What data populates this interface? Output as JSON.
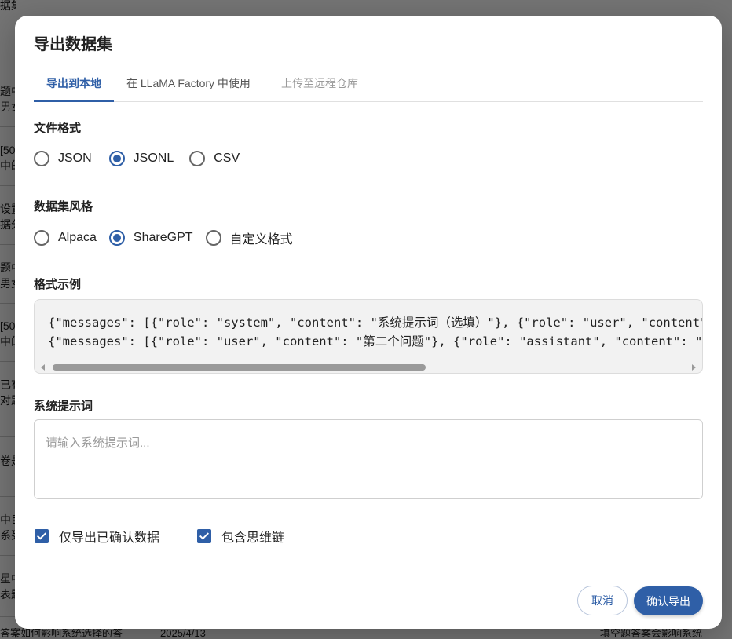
{
  "background": {
    "header_fragment": "据集",
    "row_fragments": [
      "题中",
      "男女",
      "[50",
      "中的",
      "设置",
      "据分",
      "题中",
      "男女",
      "[50",
      "中的",
      "已有",
      "对题",
      "卷是",
      "中目",
      "系列",
      "星中",
      "表题"
    ],
    "bottom_text": "答案如何影响系统选择的答",
    "bottom_date": "2025/4/13",
    "bottom_right": "填空题答案会影响系统"
  },
  "dialog": {
    "title": "导出数据集",
    "tabs": [
      {
        "label": "导出到本地",
        "state": "active"
      },
      {
        "label": "在 LLaMA Factory 中使用",
        "state": "normal"
      },
      {
        "label": "上传至远程仓库",
        "state": "disabled"
      }
    ],
    "file_format": {
      "label": "文件格式",
      "options": [
        "JSON",
        "JSONL",
        "CSV"
      ],
      "selected": "JSONL"
    },
    "dataset_style": {
      "label": "数据集风格",
      "options": [
        "Alpaca",
        "ShareGPT",
        "自定义格式"
      ],
      "selected": "ShareGPT"
    },
    "format_example": {
      "label": "格式示例",
      "lines": [
        "{\"messages\": [{\"role\": \"system\", \"content\": \"系统提示词（选填）\"}, {\"role\": \"user\", \"content\": \"问题\"}, {\"role\": \"assistant\", \"content\": \"答案\"}]}",
        "{\"messages\": [{\"role\": \"user\", \"content\": \"第二个问题\"}, {\"role\": \"assistant\", \"content\": \"第二个答案\"}]}"
      ]
    },
    "system_prompt": {
      "label": "系统提示词",
      "placeholder": "请输入系统提示词...",
      "value": ""
    },
    "checkboxes": [
      {
        "label": "仅导出已确认数据",
        "checked": true
      },
      {
        "label": "包含思维链",
        "checked": true
      }
    ],
    "buttons": {
      "cancel": "取消",
      "confirm": "确认导出"
    }
  },
  "colors": {
    "primary": "#2f5fa7",
    "overlay": "#777777",
    "code_bg": "#f2f2f2"
  }
}
